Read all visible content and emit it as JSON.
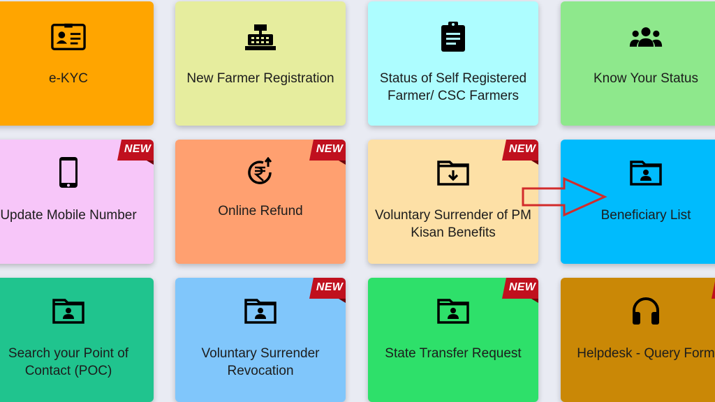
{
  "badge_text": "NEW",
  "tiles": [
    {
      "label1": "e-KYC",
      "label2": "",
      "icon": "id-card-icon",
      "color": "#ffa500"
    },
    {
      "label1": "New Farmer Registration",
      "label2": "",
      "icon": "cash-register-icon",
      "color": "#e6ed9e"
    },
    {
      "label1": "Status of Self Registered",
      "label2": "Farmer/ CSC Farmers",
      "icon": "clipboard-icon",
      "color": "#adfdff"
    },
    {
      "label1": "Know Your Status",
      "label2": "",
      "icon": "users-icon",
      "color": "#8ee88c"
    },
    {
      "label1": "Update Mobile Number",
      "label2": "",
      "icon": "mobile-phone-icon",
      "color": "#f7c6f9",
      "new": true
    },
    {
      "label1": "Online Refund",
      "label2": "",
      "icon": "rupee-refund-icon",
      "color": "#ffa070",
      "new": true
    },
    {
      "label1": "Voluntary Surrender of PM",
      "label2": "Kisan Benefits",
      "icon": "folder-download-icon",
      "color": "#fde0a6",
      "new": true
    },
    {
      "label1": "Beneficiary List",
      "label2": "",
      "icon": "folder-user-icon",
      "color": "#00bbfd"
    },
    {
      "label1": "Search your Point of",
      "label2": "Contact (POC)",
      "icon": "folder-user-icon",
      "color": "#20c48e"
    },
    {
      "label1": "Voluntary Surrender",
      "label2": "Revocation",
      "icon": "folder-user-icon",
      "color": "#80c6fb",
      "new": true
    },
    {
      "label1": "State Transfer Request",
      "label2": "",
      "icon": "folder-user-icon",
      "color": "#2ee06a",
      "new": true
    },
    {
      "label1": "Helpdesk - Query Form",
      "label2": "",
      "icon": "headphones-icon",
      "color": "#ca8806",
      "new": true
    }
  ],
  "colors": {
    "badge": "#c0101e",
    "arrow": "#d22b2b"
  }
}
